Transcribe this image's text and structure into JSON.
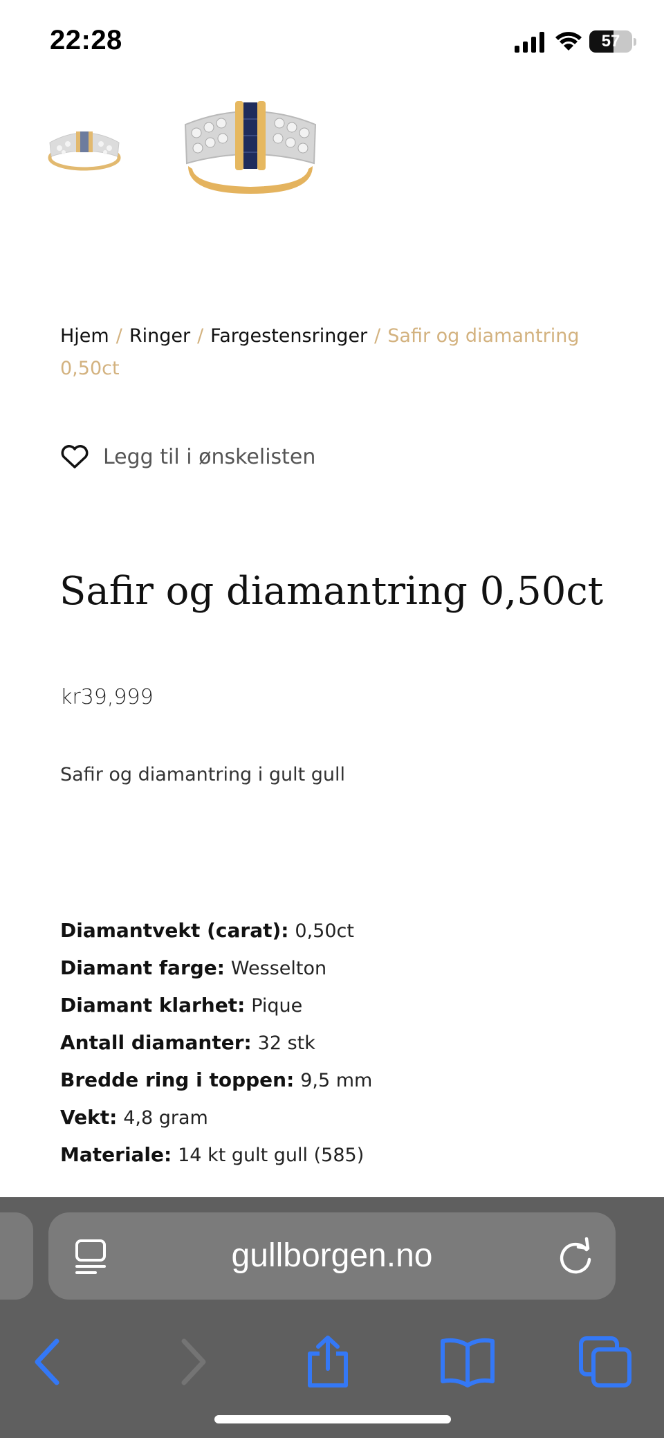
{
  "status_bar": {
    "time": "22:28",
    "battery_level": "57",
    "icons": [
      "cellular-signal-icon",
      "wifi-icon",
      "battery-icon"
    ]
  },
  "gallery": {
    "thumbnails": [
      "ring-thumbnail-small",
      "ring-thumbnail-large"
    ]
  },
  "breadcrumb": {
    "items": [
      "Hjem",
      "Ringer",
      "Fargestensringer"
    ],
    "separator": "/",
    "current": "Safir og diamantring 0,50ct"
  },
  "wishlist": {
    "label": "Legg til i ønskelisten",
    "icon": "heart-icon"
  },
  "product": {
    "title": "Safir og diamantring 0,50ct",
    "price": "kr39,999",
    "short_description": "Safir og diamantring i gult gull",
    "specs": [
      {
        "label": "Diamantvekt (carat):",
        "value": "0,50ct"
      },
      {
        "label": "Diamant farge:",
        "value": "Wesselton"
      },
      {
        "label": "Diamant klarhet:",
        "value": "Pique"
      },
      {
        "label": "Antall diamanter:",
        "value": "32 stk"
      },
      {
        "label": "Bredde ring i toppen:",
        "value": "9,5 mm"
      },
      {
        "label": "Vekt:",
        "value": "4,8 gram"
      },
      {
        "label": "Materiale:",
        "value": "14 kt gult gull (585)"
      }
    ]
  },
  "browser": {
    "url": "gullborgen.no",
    "toolbar_icons": [
      "back-icon",
      "forward-icon",
      "share-icon",
      "bookmarks-icon",
      "tabs-icon"
    ]
  },
  "colors": {
    "accent_gold": "#d3b27f",
    "ios_blue": "#3478f6",
    "toolbar_bg": "#5f5f5f"
  }
}
